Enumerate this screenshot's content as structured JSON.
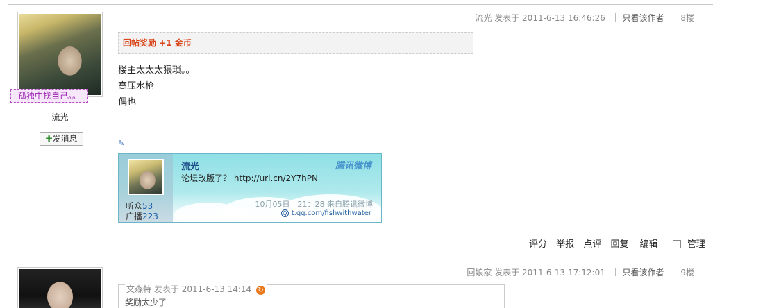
{
  "post1": {
    "author": "流光",
    "signature_tag": "孤独中找自己。。",
    "message_button": "发消息",
    "message_plus": "✚",
    "meta": {
      "author": "流光",
      "posted_label": "发表于",
      "datetime": "2011-6-13 16:46:26",
      "only_author": "只看该作者",
      "floor": "8楼"
    },
    "reward": "回帖奖励 +1 金币",
    "content_lines": [
      "楼主太太太猥琐。。",
      "高压水枪",
      "偶也"
    ],
    "pen_icon": "✎",
    "weibo_card": {
      "name": "流光",
      "brand": "腾讯微博",
      "text": "论坛改版了？ http://url.cn/2Y7hPN",
      "listeners_label": "听众",
      "listeners_count": "53",
      "broadcasts_label": "广播",
      "broadcasts_count": "223",
      "time": "10月05日　21：28 来自腾讯微博",
      "link": "t.qq.com/fishwithwater",
      "link_icon": "Q"
    },
    "actions": {
      "rate": "评分",
      "report": "举报",
      "comment": "点评",
      "reply": "回复",
      "edit": "编辑",
      "manage": "管理"
    }
  },
  "post2": {
    "meta": {
      "author": "回娘家",
      "posted_label": "发表于",
      "datetime": "2011-6-13 17:12:01",
      "only_author": "只看该作者",
      "floor": "9楼"
    },
    "quote": {
      "author": "文森特",
      "posted_label": "发表于",
      "datetime": "2011-6-13 14:14",
      "arrow_icon": "↻",
      "text": "奖励太少了"
    }
  }
}
